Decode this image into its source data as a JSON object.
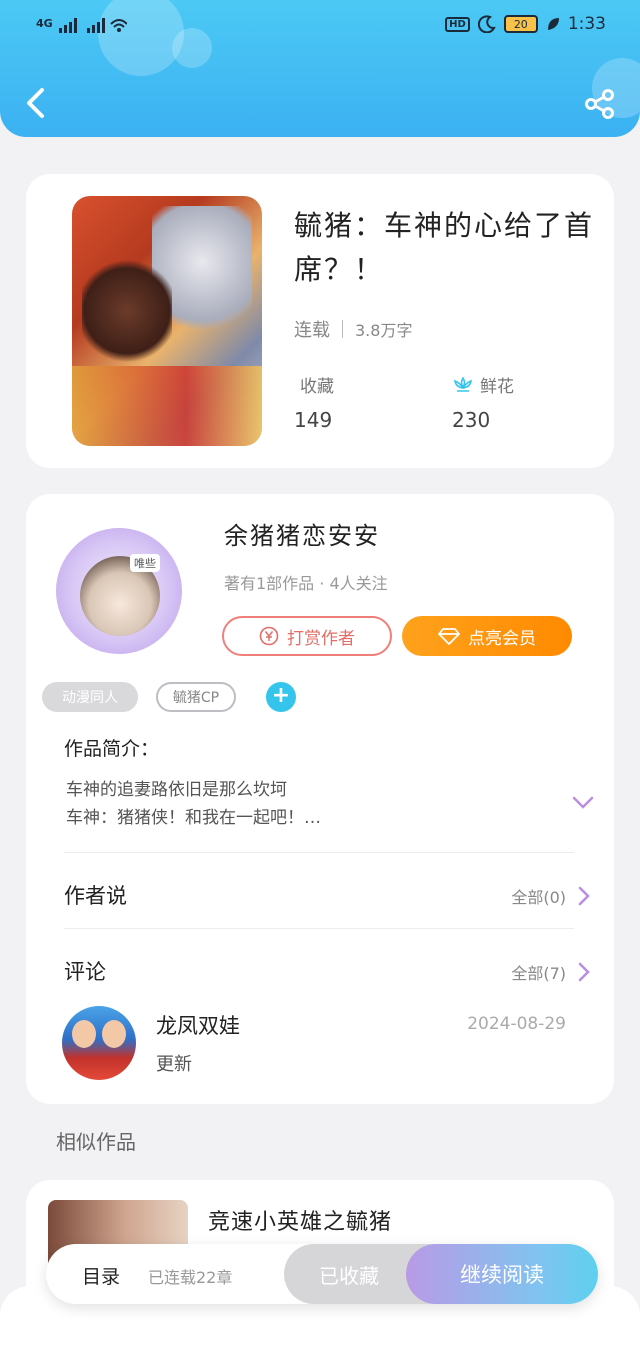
{
  "status_bar": {
    "network": "4G",
    "hd": "HD",
    "battery": "20",
    "time": "1:33"
  },
  "book": {
    "title": "毓猪：车神的心给了首席？！",
    "status": "连载",
    "word_count": "3.8万字",
    "favorites_label": "收藏",
    "favorites_value": "149",
    "flowers_label": "鲜花",
    "flowers_value": "230"
  },
  "author": {
    "avatar_tag": "唯些",
    "name": "余猪猪恋安安",
    "info": "著有1部作品 · 4人关注",
    "tip_button": "打赏作者",
    "vip_button": "点亮会员",
    "tags": [
      "动漫同人",
      "毓猪CP"
    ]
  },
  "intro": {
    "heading": "作品简介：",
    "lines": [
      "车神的追妻路依旧是那么坎坷",
      "车神：猪猪侠！和我在一起吧！…"
    ]
  },
  "author_says": {
    "label": "作者说",
    "all": "全部(0)"
  },
  "comments": {
    "label": "评论",
    "all": "全部(7)",
    "item": {
      "user": "龙凤双娃",
      "date": "2024-08-29",
      "text": "更新"
    }
  },
  "similar": {
    "heading": "相似作品",
    "item_title": "竞速小英雄之毓猪"
  },
  "bottom_bar": {
    "toc": "目录",
    "chapters": "已连载22章",
    "favorited": "已收藏",
    "continue": "继续阅读"
  },
  "colors": {
    "header_blue": "#3bb1f2",
    "vip_orange": "#ff8a00",
    "tip_red": "#e46d67",
    "accent_cyan": "#35c5ec"
  }
}
